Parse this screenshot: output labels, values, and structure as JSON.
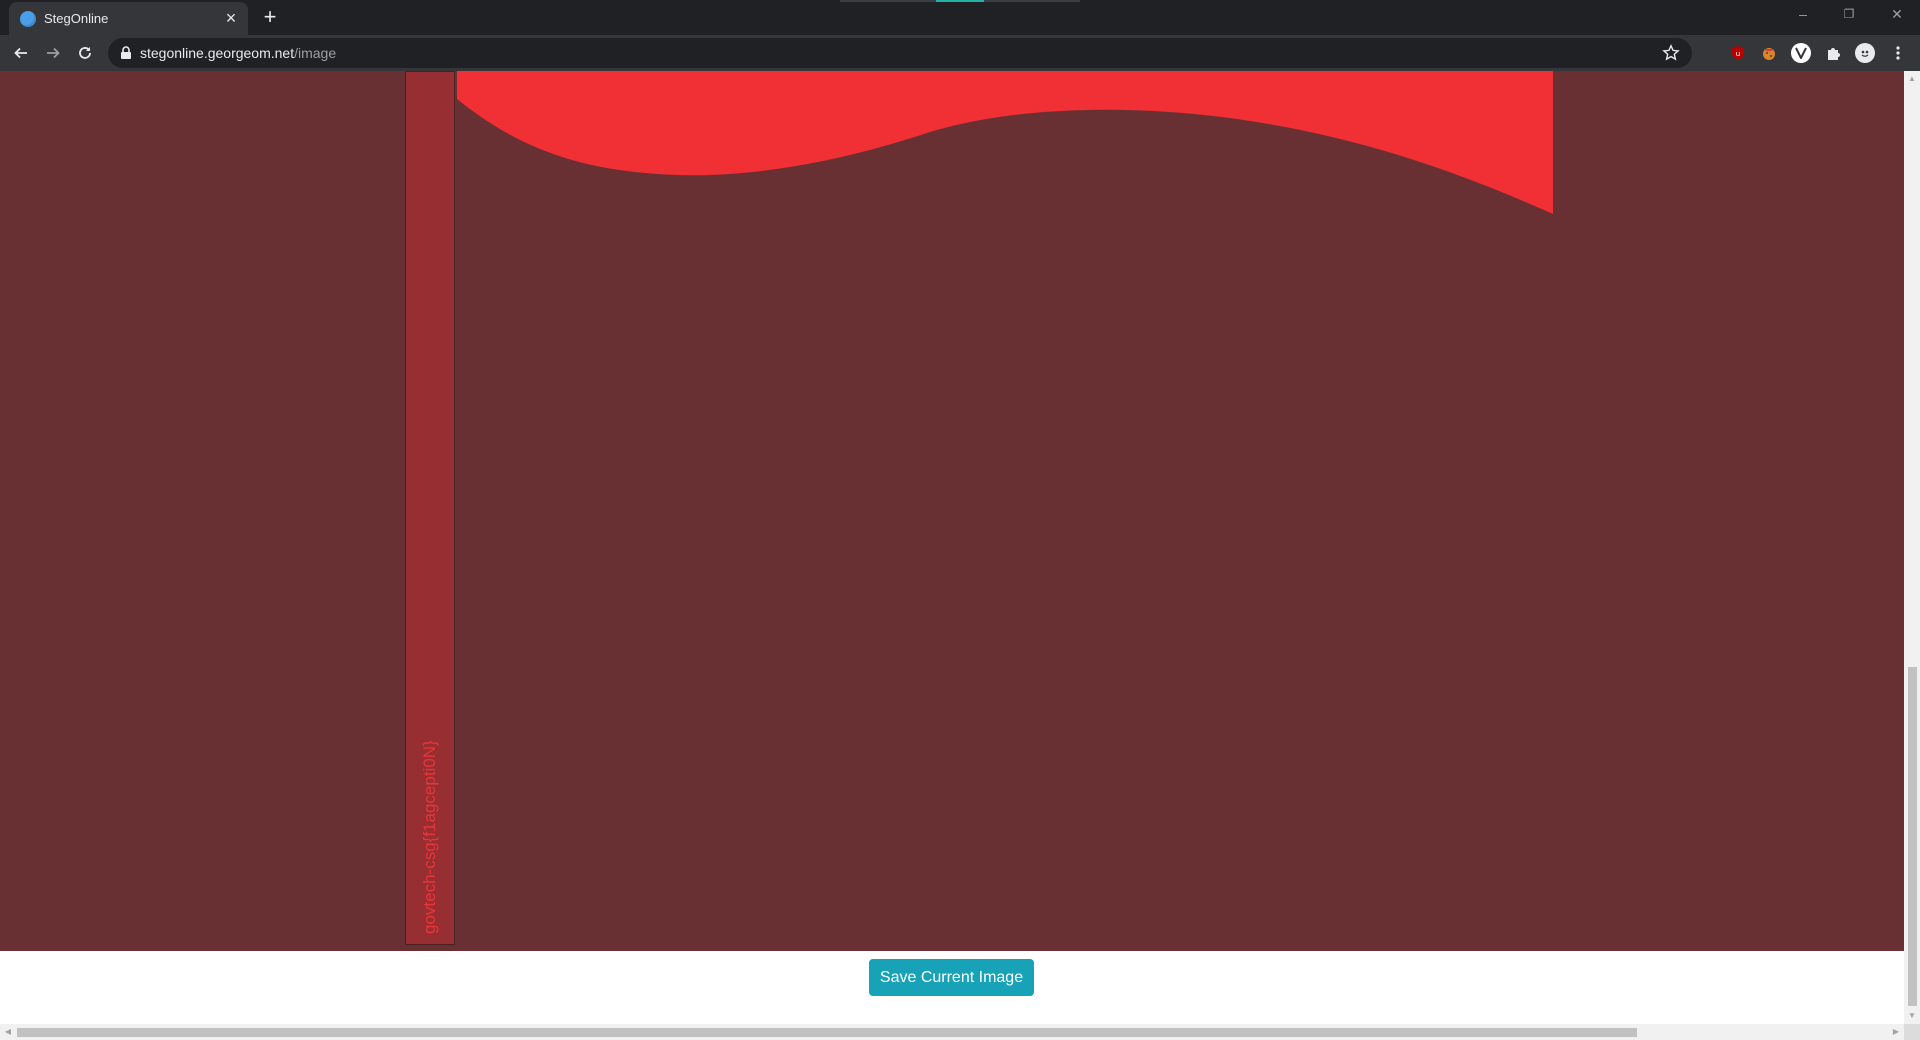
{
  "browser": {
    "tab": {
      "title": "StegOnline",
      "close_glyph": "×"
    },
    "new_tab_glyph": "+",
    "window_controls": {
      "minimize": "–",
      "restore": "❐",
      "close": "✕"
    },
    "address": {
      "host": "stegonline.georgeom.net",
      "path": "/image"
    },
    "colors": {
      "chrome_dark": "#202124",
      "chrome_toolbar": "#35363a"
    },
    "extensions": [
      {
        "name": "ublock-origin-icon",
        "color": "#b70000"
      },
      {
        "name": "cookie-extension-icon",
        "color": "#d94c2b"
      },
      {
        "name": "vpn-extension-icon",
        "color": "#ffffff"
      },
      {
        "name": "puzzle-icon",
        "color": "#e8eaed"
      },
      {
        "name": "profile-avatar-icon",
        "color": "#e8eaed"
      },
      {
        "name": "kebab-menu-icon",
        "color": "#e8eaed"
      }
    ]
  },
  "page": {
    "canvas_color": "#683033",
    "strip_color": "#962e32",
    "flag_color": "#f03034",
    "hidden_text": "govtech-csg{f1agcepti0N}",
    "hidden_text_color": "#e8353a",
    "save_button": {
      "label": "Save Current Image",
      "color": "#17a2b8"
    }
  }
}
